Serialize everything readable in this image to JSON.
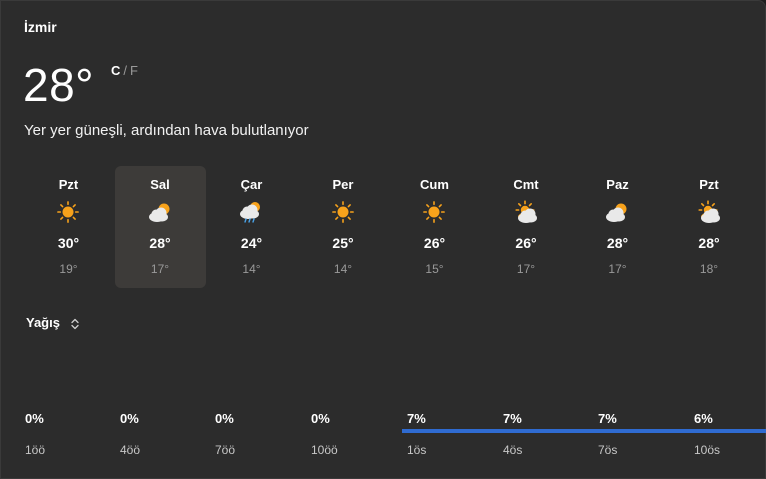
{
  "city": "İzmir",
  "current": {
    "temperature": "28°",
    "unit_c": "C",
    "unit_sep": "/",
    "unit_f": "F",
    "summary": "Yer yer güneşli, ardından hava bulutlanıyor"
  },
  "days": [
    {
      "name": "Pzt",
      "high": "30°",
      "low": "19°",
      "icon": "sunny-icon"
    },
    {
      "name": "Sal",
      "high": "28°",
      "low": "17°",
      "icon": "partly-cloudy-icon",
      "selected": true
    },
    {
      "name": "Çar",
      "high": "24°",
      "low": "14°",
      "icon": "rain-cloud-icon"
    },
    {
      "name": "Per",
      "high": "25°",
      "low": "14°",
      "icon": "sunny-icon"
    },
    {
      "name": "Cum",
      "high": "26°",
      "low": "15°",
      "icon": "sunny-icon"
    },
    {
      "name": "Cmt",
      "high": "26°",
      "low": "17°",
      "icon": "mostly-sunny-icon"
    },
    {
      "name": "Paz",
      "high": "28°",
      "low": "17°",
      "icon": "partly-cloudy-icon"
    },
    {
      "name": "Pzt",
      "high": "28°",
      "low": "18°",
      "icon": "mostly-sunny-icon"
    }
  ],
  "precipitation": {
    "label": "Yağış",
    "hours": [
      {
        "time": "1öö",
        "percent": "0%",
        "value": 0
      },
      {
        "time": "4öö",
        "percent": "0%",
        "value": 0
      },
      {
        "time": "7öö",
        "percent": "0%",
        "value": 0
      },
      {
        "time": "10öö",
        "percent": "0%",
        "value": 0
      },
      {
        "time": "1ös",
        "percent": "7%",
        "value": 7
      },
      {
        "time": "4ös",
        "percent": "7%",
        "value": 7
      },
      {
        "time": "7ös",
        "percent": "7%",
        "value": 7
      },
      {
        "time": "10ös",
        "percent": "6%",
        "value": 6
      }
    ]
  },
  "colors": {
    "sun": "#f7a21b",
    "cloud": "#e9e9e9",
    "rain": "#4aa3e8",
    "bar": "#2f6bd1"
  }
}
